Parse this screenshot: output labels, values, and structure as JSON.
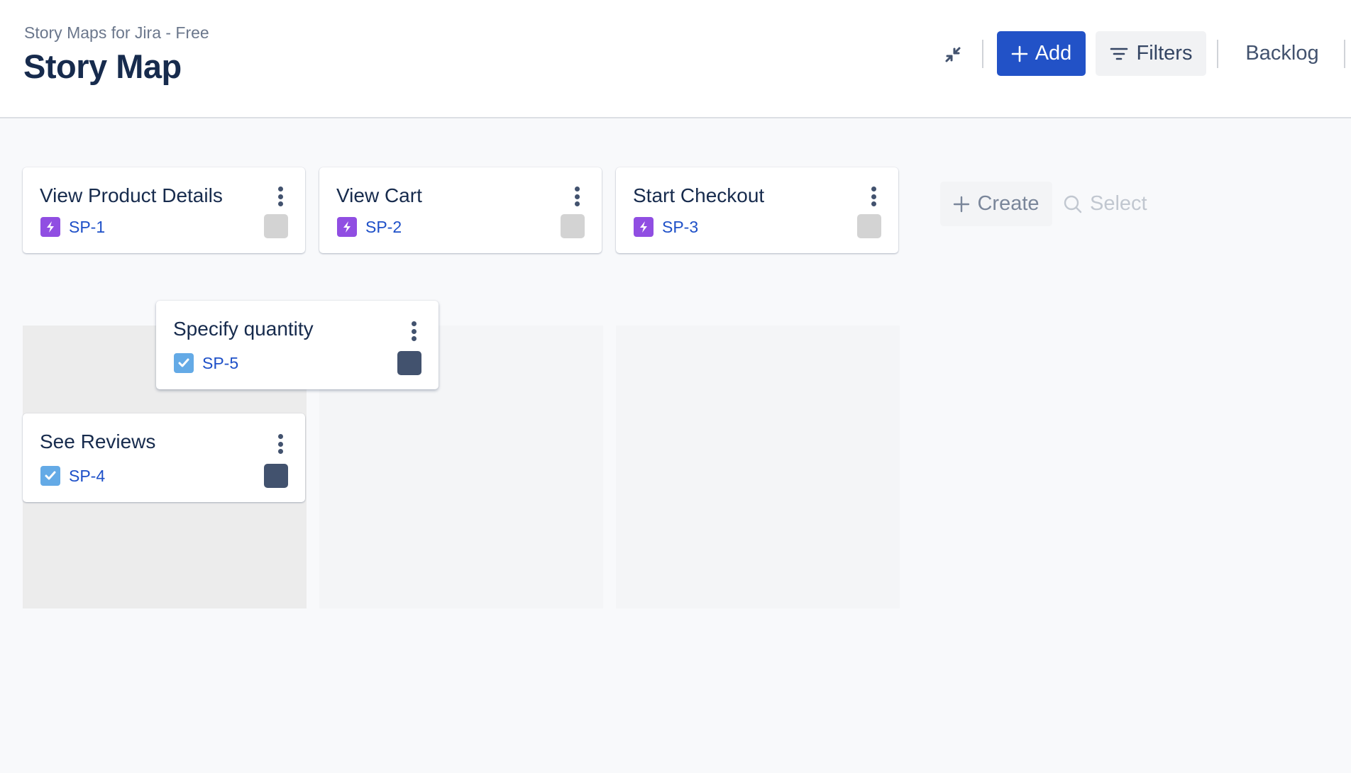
{
  "header": {
    "subtitle": "Story Maps for Jira - Free",
    "title": "Story Map",
    "collapse_icon": "collapse-arrows-icon",
    "add_label": "Add",
    "filters_label": "Filters",
    "backlog_label": "Backlog"
  },
  "colors": {
    "primary": "#2252c7",
    "epic": "#904ee2",
    "task": "#64aae6",
    "link": "#1e50c8",
    "status_todo": "#d3d3d3",
    "status_done": "#42526e"
  },
  "activities": [
    {
      "title": "View Product Details",
      "key": "SP-1",
      "type": "epic",
      "status": "todo"
    },
    {
      "title": "View Cart",
      "key": "SP-2",
      "type": "epic",
      "status": "todo"
    },
    {
      "title": "Start Checkout",
      "key": "SP-3",
      "type": "epic",
      "status": "todo"
    }
  ],
  "stories": [
    {
      "title": "Specify quantity",
      "key": "SP-5",
      "type": "task",
      "status": "done",
      "state": "dragging"
    },
    {
      "title": "See Reviews",
      "key": "SP-4",
      "type": "task",
      "status": "done",
      "column": 1
    }
  ],
  "actions": {
    "create_label": "Create",
    "select_label": "Select"
  }
}
